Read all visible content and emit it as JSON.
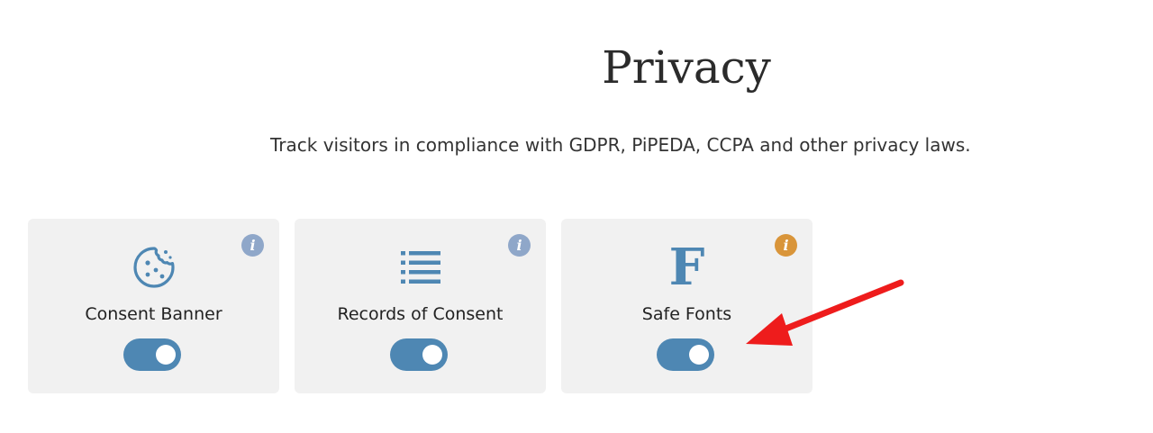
{
  "header": {
    "title": "Privacy",
    "subtitle": "Track visitors in compliance with GDPR, PiPEDA, CCPA and other privacy laws."
  },
  "cards": [
    {
      "label": "Consent Banner",
      "icon": "cookie-icon",
      "info": "i",
      "info_color": "#8fa7c9",
      "toggle_on": true
    },
    {
      "label": "Records of Consent",
      "icon": "list-icon",
      "info": "i",
      "info_color": "#8fa7c9",
      "toggle_on": true
    },
    {
      "label": "Safe Fonts",
      "icon": "font-f-icon",
      "icon_glyph": "F",
      "info": "i",
      "info_color": "#d9953a",
      "toggle_on": true
    }
  ],
  "colors": {
    "accent": "#4e87b3",
    "card_bg": "#f1f1f1",
    "annotation_arrow": "#ee1c1c"
  }
}
